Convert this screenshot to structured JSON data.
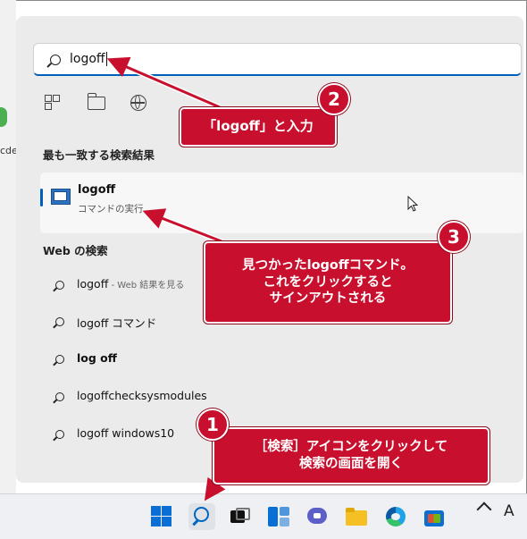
{
  "search": {
    "query": "logoff"
  },
  "filters": [
    "apps-icon",
    "folder-icon",
    "globe-icon"
  ],
  "best_match": {
    "heading": "最も一致する検索結果",
    "title": "logoff",
    "subtitle": "コマンドの実行"
  },
  "web": {
    "heading": "Web の検索",
    "items": [
      {
        "text": "logoff",
        "hint": " - Web 結果を見る"
      },
      {
        "text": "logoff コマンド",
        "hint": ""
      },
      {
        "text": "log off",
        "hint": ""
      },
      {
        "text": "logoffchecksysmodules",
        "hint": ""
      },
      {
        "text": "logoff windows10",
        "hint": ""
      }
    ]
  },
  "desktop": {
    "partial_label": "cde"
  },
  "annotations": {
    "callout1": {
      "number": "1",
      "line1": "［検索］アイコンをクリックして",
      "line2": "検索の画面を開く"
    },
    "callout2": {
      "number": "2",
      "text": "「logoff」と入力"
    },
    "callout3": {
      "number": "3",
      "line1": "見つかったlogoffコマンド。",
      "line2": "これをクリックすると",
      "line3": "サインアウトされる"
    }
  },
  "taskbar": {
    "icons": [
      "windows-start-icon",
      "search-icon",
      "task-view-icon",
      "widgets-icon",
      "chat-icon",
      "file-explorer-icon",
      "edge-icon",
      "store-icon"
    ],
    "ime_indicator": "A"
  },
  "colors": {
    "callout": "#c8102e",
    "accent": "#005fb8"
  }
}
